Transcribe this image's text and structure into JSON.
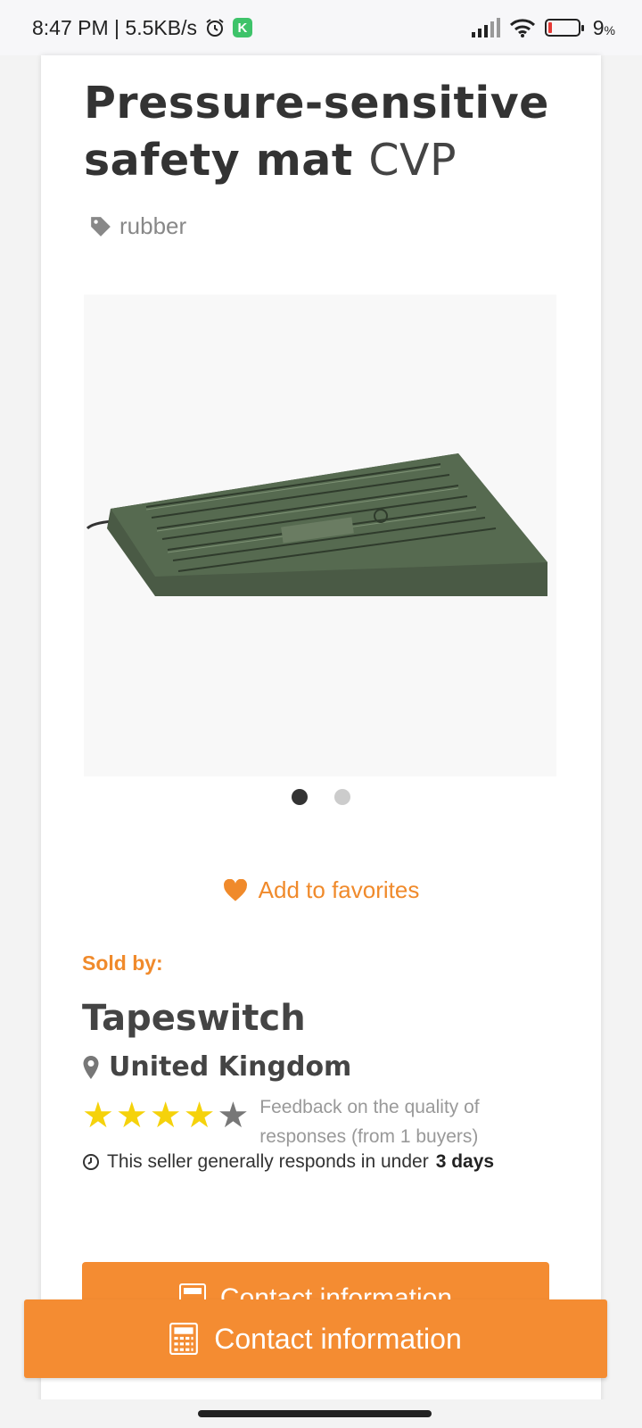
{
  "status_bar": {
    "time_speed": "8:47 PM | 5.5KB/s",
    "battery": "9",
    "battery_unit": "%"
  },
  "product": {
    "title_bold": "Pressure-sensitive safety mat",
    "title_model": "CVP",
    "tag": "rubber",
    "image_alt": "Green rubber pressure-sensitive safety mat",
    "carousel_count": 2,
    "carousel_active": 1
  },
  "actions": {
    "favorites_label": "Add to favorites",
    "contact_label": "Contact information"
  },
  "seller": {
    "sold_by_label": "Sold by:",
    "name": "Tapeswitch",
    "country": "United Kingdom",
    "rating": 4,
    "rating_max": 5,
    "feedback_text": "Feedback on the quality of responses (from 1 buyers)",
    "response_prefix": "This seller generally responds in under",
    "response_time": "3 days"
  },
  "colors": {
    "accent": "#f48c32",
    "star": "#f5d20b"
  }
}
